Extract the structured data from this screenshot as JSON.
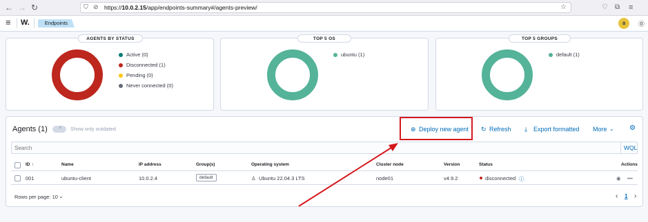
{
  "browser": {
    "url_prefix": "https://",
    "url_host": "10.0.2.15",
    "url_path": "/app/endpoints-summary#/agents-preview/"
  },
  "header": {
    "logo": "W.",
    "breadcrumb": "Endpoints",
    "avatar_letter": "a"
  },
  "panels": [
    {
      "title": "AGENTS BY STATUS",
      "legend": [
        {
          "label": "Active (0)",
          "color": "#017d73"
        },
        {
          "label": "Disconnected (1)",
          "color": "#bd271e"
        },
        {
          "label": "Pending (0)",
          "color": "#fec514"
        },
        {
          "label": "Never connected (0)",
          "color": "#646a77"
        }
      ],
      "donut_color": "#bd271e"
    },
    {
      "title": "TOP 5 OS",
      "legend": [
        {
          "label": "ubuntu (1)",
          "color": "#54b399"
        }
      ],
      "donut_color": "#54b399"
    },
    {
      "title": "TOP 5 GROUPS",
      "legend": [
        {
          "label": "default (1)",
          "color": "#54b399"
        }
      ],
      "donut_color": "#54b399"
    }
  ],
  "agents": {
    "title": "Agents (1)",
    "toggle_label": "Show only outdated",
    "deploy_label": "Deploy new agent",
    "refresh_label": "Refresh",
    "export_label": "Export formatted",
    "more_label": "More",
    "search_placeholder": "Search",
    "wql_label": "WQL",
    "columns": [
      "ID",
      "Name",
      "IP address",
      "Group(s)",
      "Operating system",
      "Cluster node",
      "Version",
      "Status",
      "Actions"
    ],
    "rows": [
      {
        "id": "001",
        "name": "ubuntu-client",
        "ip": "10.0.2.4",
        "group": "default",
        "os": "Ubuntu 22.04.3 LTS",
        "node": "node01",
        "version": "v4.9.2",
        "status": "disconnected"
      }
    ],
    "rows_per_page": "Rows per page: 10",
    "current_page": "1"
  },
  "colors": {
    "accent": "#006bb8",
    "annotation_red": "#d4181c",
    "disconnected": "#bd271e"
  }
}
